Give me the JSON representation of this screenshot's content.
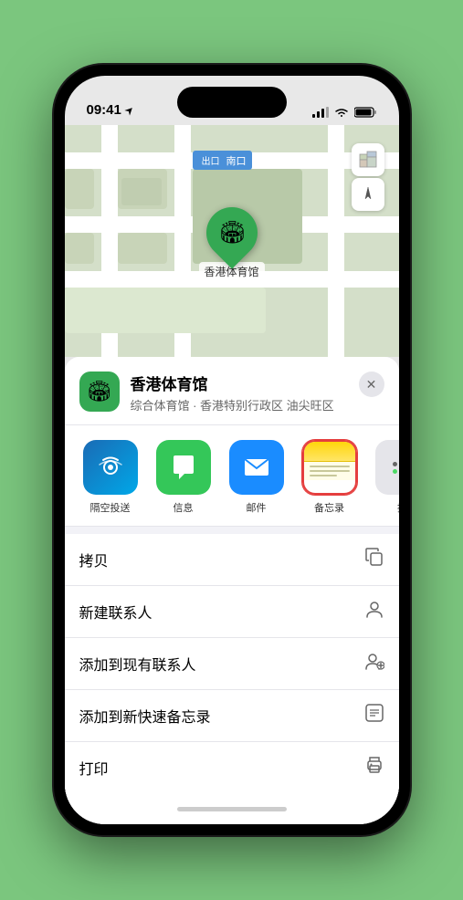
{
  "status_bar": {
    "time": "09:41",
    "location_arrow": "▶"
  },
  "map": {
    "label_text": "南口",
    "stadium_name": "香港体育馆",
    "controls": {
      "map_icon": "🗺",
      "location_icon": "⇡"
    }
  },
  "sheet": {
    "venue_name": "香港体育馆",
    "venue_desc": "综合体育馆 · 香港特别行政区 油尖旺区",
    "close_label": "✕"
  },
  "share_actions": [
    {
      "id": "airdrop",
      "label": "隔空投送",
      "type": "airdrop"
    },
    {
      "id": "messages",
      "label": "信息",
      "type": "messages"
    },
    {
      "id": "mail",
      "label": "邮件",
      "type": "mail"
    },
    {
      "id": "notes",
      "label": "备忘录",
      "type": "notes"
    },
    {
      "id": "more",
      "label": "推",
      "type": "more"
    }
  ],
  "menu_items": [
    {
      "id": "copy",
      "label": "拷贝",
      "icon": "copy"
    },
    {
      "id": "new-contact",
      "label": "新建联系人",
      "icon": "person"
    },
    {
      "id": "add-contact",
      "label": "添加到现有联系人",
      "icon": "person-add"
    },
    {
      "id": "quick-note",
      "label": "添加到新快速备忘录",
      "icon": "note"
    },
    {
      "id": "print",
      "label": "打印",
      "icon": "print"
    }
  ],
  "colors": {
    "green": "#34a853",
    "blue": "#1a8cff",
    "red_border": "#e53e3e",
    "notes_yellow": "#ffd60a"
  }
}
